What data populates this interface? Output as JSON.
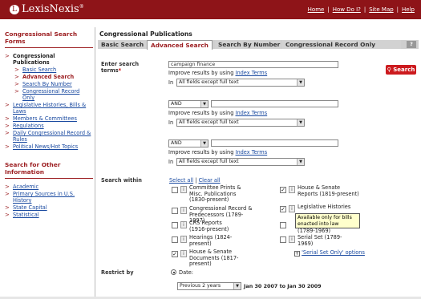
{
  "brand": {
    "name": "LexisNexis",
    "tm": "®"
  },
  "toplinks": [
    "Home",
    "How Do I?",
    "Site Map",
    "Help"
  ],
  "sidebar": {
    "heading": "Congressional Search Forms",
    "section_label": "Congressional Publications",
    "subitems": [
      "Basic Search",
      "Advanced Search",
      "Search By Number",
      "Congressional Record Only"
    ],
    "items": [
      "Legislative Histories, Bills & Laws",
      "Members & Committees",
      "Regulations",
      "Daily Congressional Record & Rules",
      "Political News/Hot Topics"
    ],
    "other_heading": "Search for Other Information",
    "other_items": [
      "Academic",
      "Primary Sources in U.S. History",
      "State Capital",
      "Statistical"
    ]
  },
  "main": {
    "title": "Congressional Publications",
    "tabs": [
      "Basic Search",
      "Advanced Search",
      "Search By Number",
      "Congressional Record Only"
    ],
    "help": "?",
    "enter_label": "Enter search terms",
    "required_mark": "*",
    "term1": "campaign finance",
    "improve_text": "Improve results by using",
    "index_terms": "Index Terms",
    "in_label": "In",
    "field_option": "All fields except full text",
    "connector": "AND",
    "search_button": "Search",
    "search_within_label": "Search within",
    "select_all": "Select all",
    "clear_all": "Clear all",
    "left_options": [
      {
        "label": "Committee Prints & Misc. Publications (1830-present)",
        "checked": false
      },
      {
        "label": "Congressional Record & Predecessors (1789-1997)",
        "checked": false
      },
      {
        "label": "CRS Reports (1916-present)",
        "checked": false
      },
      {
        "label": "Hearings (1824-present)",
        "checked": false
      },
      {
        "label": "House & Senate Documents (1817-present)",
        "checked": true
      }
    ],
    "right_options": [
      {
        "label": "House & Senate Reports (1819-present)",
        "checked": true
      },
      {
        "label": "Legislative Histories",
        "checked": true
      },
      {
        "label": "(1789-1969)",
        "checked": false
      },
      {
        "label": "Serial Set (1789-1969)",
        "checked": false
      }
    ],
    "serial_link": "'Serial Set Only' options",
    "tooltip": "Available only for bills enacted into law",
    "restrict_label": "Restrict by",
    "date_label": "Date:",
    "date_option": "Previous 2 years",
    "date_range": "Jan 30 2007 to Jan 30 2009"
  }
}
